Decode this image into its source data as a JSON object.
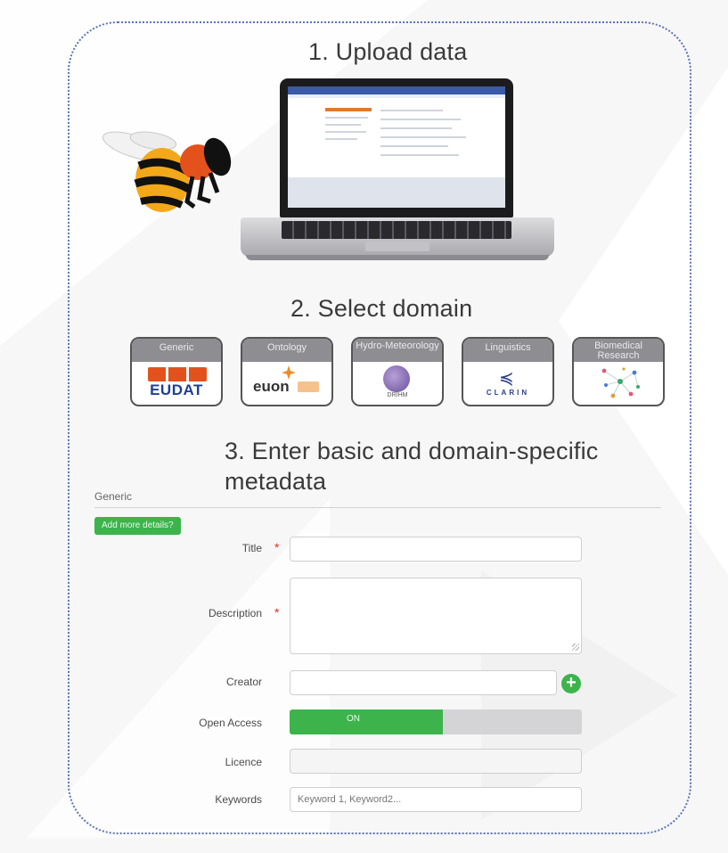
{
  "steps": {
    "upload": "1. Upload data",
    "select": "2. Select domain",
    "enter": "3. Enter basic and domain-specific metadata"
  },
  "domains": [
    {
      "label": "Generic",
      "logo_text": "EUDAT",
      "icon": "eudat-logo"
    },
    {
      "label": "Ontology",
      "logo_text": "euon",
      "icon": "euon-logo"
    },
    {
      "label": "Hydro-Meteorology",
      "logo_text": "DRIHM",
      "icon": "drihm-logo"
    },
    {
      "label": "Linguistics",
      "logo_text": "CLARIN",
      "icon": "clarin-logo"
    },
    {
      "label": "Biomedical Research",
      "logo_text": "",
      "icon": "network-graph-icon"
    }
  ],
  "form": {
    "section": "Generic",
    "add_details": "Add more details?",
    "title_label": "Title",
    "description_label": "Description",
    "creator_label": "Creator",
    "open_access_label": "Open Access",
    "open_access_state": "ON",
    "licence_label": "Licence",
    "keywords_label": "Keywords",
    "keywords_placeholder": "Keyword 1, Keyword2...",
    "required_mark": "*",
    "add_creator": "+"
  },
  "colors": {
    "accent_green": "#3cb44b",
    "frame_dotted": "#5b74b8",
    "required_red": "#d9302c",
    "tab_grey": "#8e8e92"
  },
  "icons": [
    "bee-mascot-icon",
    "laptop-icon",
    "add-creator-plus-icon",
    "textarea-resize-icon"
  ]
}
